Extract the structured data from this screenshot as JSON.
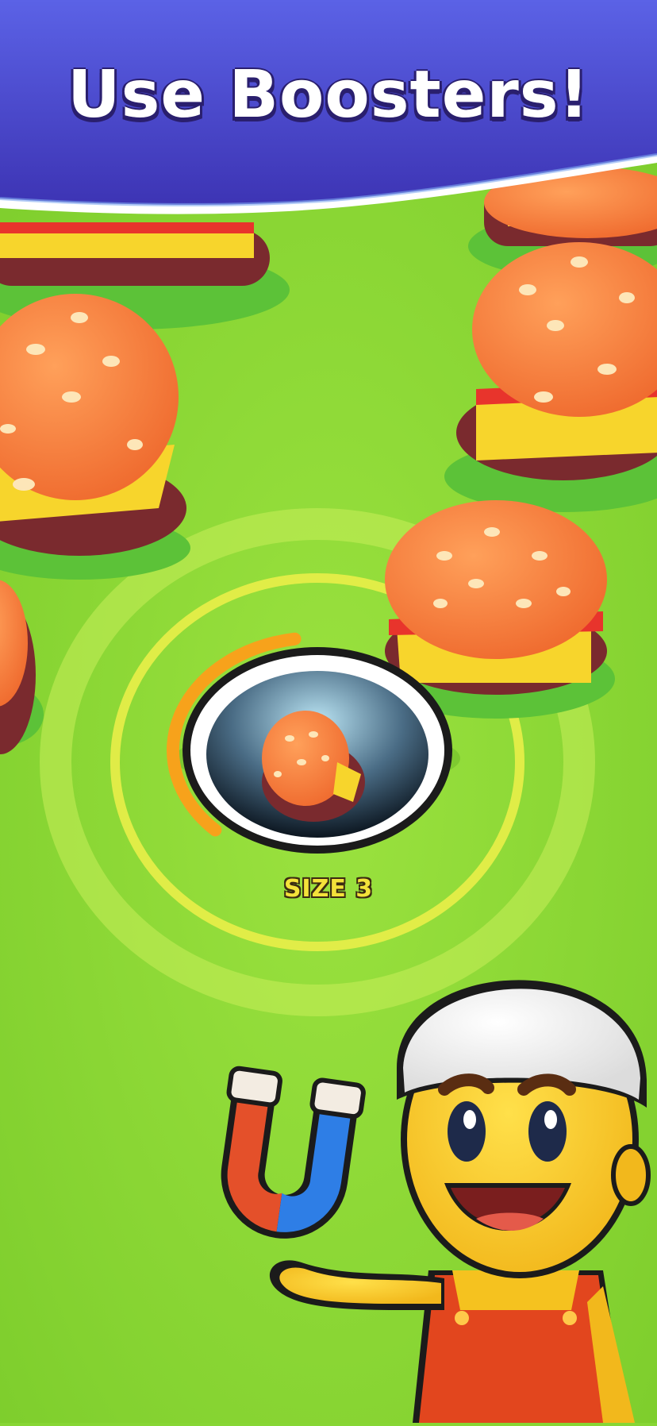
{
  "banner": {
    "title": "Use Boosters!"
  },
  "hole": {
    "size_label": "SIZE 3",
    "progress": 0.35
  },
  "booster": {
    "icon": "magnet-icon"
  },
  "colors": {
    "grass": "#87d634",
    "banner_top": "#5a5fe0",
    "banner_bottom": "#3a33b0",
    "bun": "#f5793a",
    "patty": "#7a2a2e",
    "cheese": "#f7d52c",
    "tomato": "#e8342c",
    "lettuce": "#5fd33a",
    "hole_ring": "#f7a21b",
    "shirt": "#f5c21f",
    "overalls": "#e2461e"
  }
}
